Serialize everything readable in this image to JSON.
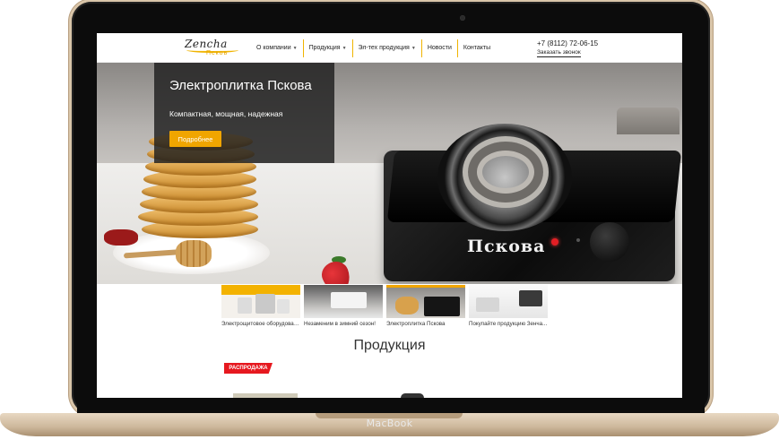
{
  "device": {
    "label": "MacBook"
  },
  "header": {
    "logo_main": "Zencha",
    "logo_sub": "Псков",
    "nav": [
      {
        "label": "О компании",
        "has_dropdown": true
      },
      {
        "label": "Продукция",
        "has_dropdown": true
      },
      {
        "label": "Эл-тех продукция",
        "has_dropdown": true
      },
      {
        "label": "Новости",
        "has_dropdown": false
      },
      {
        "label": "Контакты",
        "has_dropdown": false
      }
    ],
    "phone": "+7 (8112) 72-06-15",
    "callback": "Заказать звонок"
  },
  "hero": {
    "title": "Электроплитка Пскова",
    "subtitle": "Компактная, мощная, надежная",
    "button": "Подробнее",
    "stove_brand": "Пскова"
  },
  "thumbnails": [
    {
      "label": "Электрощитовое оборудован...",
      "active": false
    },
    {
      "label": "Незаменим в зимний сезон!",
      "active": false
    },
    {
      "label": "Электроплитка Пскова",
      "active": true
    },
    {
      "label": "Покупайте продукцию Зенча...",
      "active": false
    }
  ],
  "products": {
    "title": "Продукция",
    "badge": "РАСПРОДАЖА"
  },
  "colors": {
    "accent": "#f0a500",
    "sale": "#e6181f"
  }
}
